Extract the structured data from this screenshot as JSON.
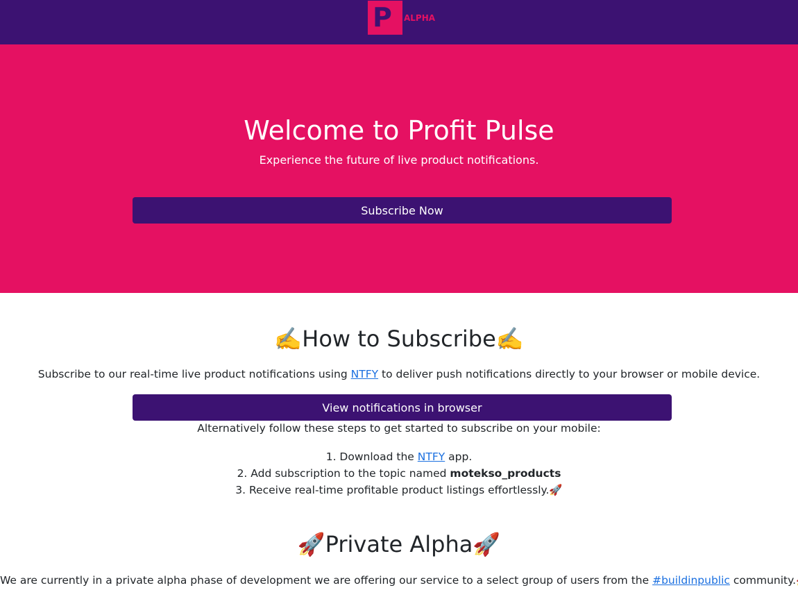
{
  "header": {
    "logo_letter": "P",
    "logo_badge": "ALPHA",
    "colors": {
      "bar": "#3c1272",
      "accent": "#e51162"
    }
  },
  "hero": {
    "title": "Welcome to Profit Pulse",
    "subtitle": "Experience the future of live product notifications.",
    "subscribe_button": "Subscribe Now"
  },
  "how_to": {
    "title_icon": "✍️",
    "title": "How to Subscribe",
    "intro_before": "Subscribe to our real-time live product notifications using ",
    "intro_link": "NTFY",
    "intro_after": " to deliver push notifications directly to your browser or mobile device.",
    "view_button": "View notifications in browser",
    "alt_text": "Alternatively follow these steps to get started to subscribe on your mobile:",
    "steps": [
      {
        "before": "1. Download the ",
        "link": "NTFY",
        "after": " app."
      },
      {
        "before": "2. Add subscription to the topic named ",
        "bold": "motekso_products"
      },
      {
        "before": "3. Receive real-time profitable product listings effortlessly.",
        "icon": "🚀"
      }
    ]
  },
  "alpha": {
    "title_icon": "🚀",
    "title": "Private Alpha",
    "text_before": "We are currently in a private alpha phase of development we are offering our service to a select group of users from the ",
    "text_link": "#buildinpublic",
    "text_after": " community.",
    "text_icon": "🚀"
  }
}
